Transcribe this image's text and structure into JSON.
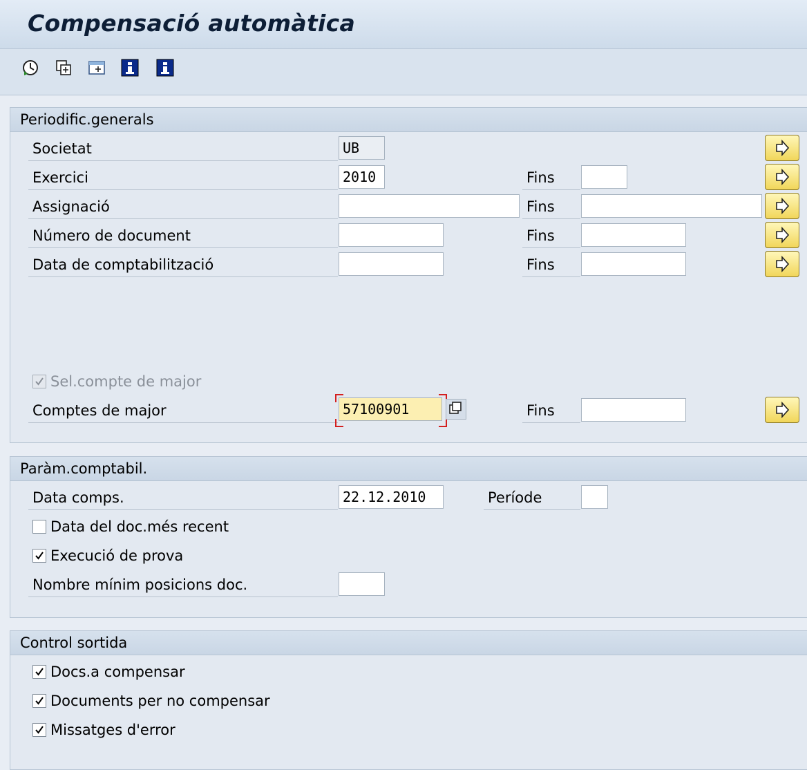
{
  "title": "Compensació automàtica",
  "toolbar": {
    "icons": [
      "execute-icon",
      "variant-icon",
      "dynamic-selection-icon",
      "info-icon",
      "info-icon"
    ]
  },
  "general": {
    "header": "Periodific.generals",
    "rows": [
      {
        "label": "Societat",
        "value": "UB"
      },
      {
        "label": "Exercici",
        "value": "2010",
        "to_label": "Fins",
        "to_value": ""
      },
      {
        "label": "Assignació",
        "value": "",
        "to_label": "Fins",
        "to_value": ""
      },
      {
        "label": "Número de document",
        "value": "",
        "to_label": "Fins",
        "to_value": ""
      },
      {
        "label": "Data de comptabilització",
        "value": "",
        "to_label": "Fins",
        "to_value": ""
      }
    ],
    "sel_checkbox": "Sel.compte de major",
    "accounts_label": "Comptes de major",
    "accounts_value": "57100901",
    "accounts_to_label": "Fins",
    "accounts_to_value": ""
  },
  "params": {
    "header": "Paràm.comptabil.",
    "date_label": "Data comps.",
    "date_value": "22.12.2010",
    "period_label": "Període",
    "period_value": "",
    "recent_label": "Data del doc.més recent",
    "test_label": "Execució de prova",
    "minpos_label": "Nombre mínim posicions doc.",
    "minpos_value": ""
  },
  "output": {
    "header": "Control sortida",
    "opt1": "Docs.a compensar",
    "opt2": "Documents per no compensar",
    "opt3": "Missatges d'error"
  },
  "colors": {
    "required_field": "#fcefb2",
    "arrow_button": "#f1d65a",
    "required_marker": "#d42020"
  }
}
